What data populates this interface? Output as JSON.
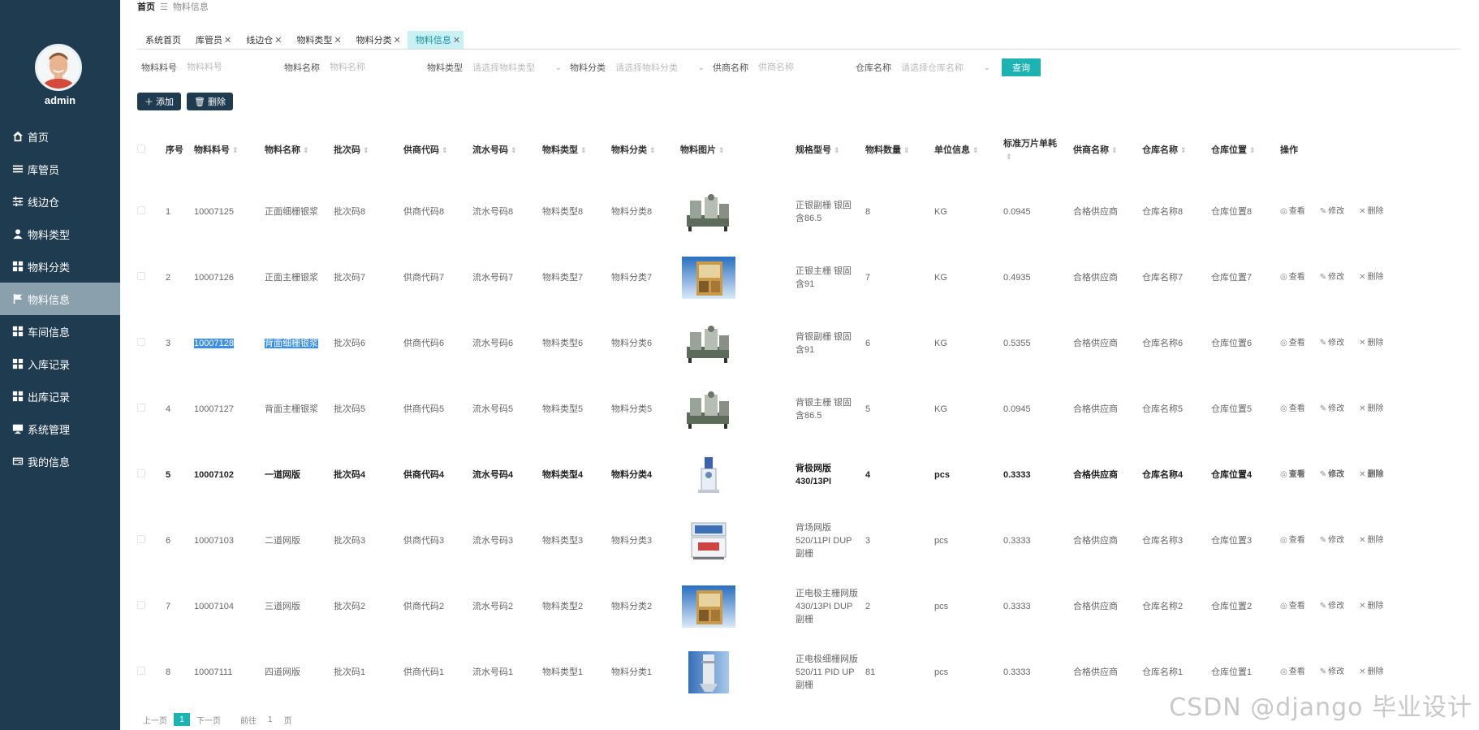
{
  "sidebar": {
    "username": "admin",
    "items": [
      {
        "label": "首页",
        "icon": "home-icon"
      },
      {
        "label": "库管员",
        "icon": "list-icon"
      },
      {
        "label": "线边仓",
        "icon": "sliders-icon"
      },
      {
        "label": "物料类型",
        "icon": "user-icon"
      },
      {
        "label": "物料分类",
        "icon": "grid-icon"
      },
      {
        "label": "物料信息",
        "icon": "flag-icon"
      },
      {
        "label": "车间信息",
        "icon": "grid-icon"
      },
      {
        "label": "入库记录",
        "icon": "grid-icon"
      },
      {
        "label": "出库记录",
        "icon": "grid-icon"
      },
      {
        "label": "系统管理",
        "icon": "monitor-icon"
      },
      {
        "label": "我的信息",
        "icon": "card-icon"
      }
    ]
  },
  "breadcrumb": {
    "home": "首页",
    "sep": "☰",
    "current": "物料信息"
  },
  "tabs": [
    {
      "label": "系统首页",
      "closable": false
    },
    {
      "label": "库管员",
      "closable": true
    },
    {
      "label": "线边仓",
      "closable": true
    },
    {
      "label": "物料类型",
      "closable": true
    },
    {
      "label": "物料分类",
      "closable": true
    },
    {
      "label": "物料信息",
      "closable": true
    }
  ],
  "filters": {
    "code_label": "物料料号",
    "code_placeholder": "物料料号",
    "name_label": "物料名称",
    "name_placeholder": "物料名称",
    "type_label": "物料类型",
    "type_placeholder": "请选择物料类型",
    "cat_label": "物料分类",
    "cat_placeholder": "请选择物料分类",
    "supplier_label": "供商名称",
    "supplier_placeholder": "供商名称",
    "warehouse_label": "仓库名称",
    "warehouse_placeholder": "请选择仓库名称",
    "query_label": "查询"
  },
  "actions": {
    "add_label": "添加",
    "delete_label": "删除"
  },
  "table": {
    "headers": {
      "idx": "序号",
      "code": "物料料号",
      "name": "物料名称",
      "batch": "批次码",
      "sup": "供商代码",
      "flow": "流水号码",
      "type": "物料类型",
      "cat": "物料分类",
      "img": "物料图片",
      "spec": "规格型号",
      "qty": "物料数量",
      "unit": "单位信息",
      "price": "标准万片单耗",
      "sname": "供商名称",
      "wh": "仓库名称",
      "loc": "仓库位置",
      "ops": "操作"
    },
    "ops": {
      "view": "查看",
      "edit": "修改",
      "del": "删除"
    },
    "rows": [
      {
        "idx": "1",
        "code": "10007125",
        "name": "正面细栅银浆",
        "batch": "批次码8",
        "sup": "供商代码8",
        "flow": "流水号码8",
        "type": "物料类型8",
        "cat": "物料分类8",
        "img": "machine",
        "spec": "正银副栅 银固含86.5",
        "qty": "8",
        "unit": "KG",
        "price": "0.0945",
        "sname": "合格供应商",
        "wh": "仓库名称8",
        "loc": "仓库位置8"
      },
      {
        "idx": "2",
        "code": "10007126",
        "name": "正面主栅银浆",
        "batch": "批次码7",
        "sup": "供商代码7",
        "flow": "流水号码7",
        "type": "物料类型7",
        "cat": "物料分类7",
        "img": "cabinet",
        "spec": "正银主栅 银固含91",
        "qty": "7",
        "unit": "KG",
        "price": "0.4935",
        "sname": "合格供应商",
        "wh": "仓库名称7",
        "loc": "仓库位置7"
      },
      {
        "idx": "3",
        "code": "10007128",
        "name": "背面细栅银浆",
        "batch": "批次码6",
        "sup": "供商代码6",
        "flow": "流水号码6",
        "type": "物料类型6",
        "cat": "物料分类6",
        "img": "machine",
        "spec": "背银副栅 银固含91",
        "qty": "6",
        "unit": "KG",
        "price": "0.5355",
        "sname": "合格供应商",
        "wh": "仓库名称6",
        "loc": "仓库位置6",
        "selected": true
      },
      {
        "idx": "4",
        "code": "10007127",
        "name": "背面主栅银浆",
        "batch": "批次码5",
        "sup": "供商代码5",
        "flow": "流水号码5",
        "type": "物料类型5",
        "cat": "物料分类5",
        "img": "machine",
        "spec": "背银主栅 银固含86.5",
        "qty": "5",
        "unit": "KG",
        "price": "0.0945",
        "sname": "合格供应商",
        "wh": "仓库名称5",
        "loc": "仓库位置5"
      },
      {
        "idx": "5",
        "code": "10007102",
        "name": "一道网版",
        "batch": "批次码4",
        "sup": "供商代码4",
        "flow": "流水号码4",
        "type": "物料类型4",
        "cat": "物料分类4",
        "img": "press",
        "spec": "背极网版430/13PI",
        "qty": "4",
        "unit": "pcs",
        "price": "0.3333",
        "sname": "合格供应商",
        "wh": "仓库名称4",
        "loc": "仓库位置4",
        "bold": true
      },
      {
        "idx": "6",
        "code": "10007103",
        "name": "二道网版",
        "batch": "批次码3",
        "sup": "供商代码3",
        "flow": "流水号码3",
        "type": "物料类型3",
        "cat": "物料分类3",
        "img": "tablet",
        "spec": "背场网版520/11PI DUP副栅",
        "qty": "3",
        "unit": "pcs",
        "price": "0.3333",
        "sname": "合格供应商",
        "wh": "仓库名称3",
        "loc": "仓库位置3"
      },
      {
        "idx": "7",
        "code": "10007104",
        "name": "三道网版",
        "batch": "批次码2",
        "sup": "供商代码2",
        "flow": "流水号码2",
        "type": "物料类型2",
        "cat": "物料分类2",
        "img": "cabinet",
        "spec": "正电极主栅网版 430/13PI DUP副栅",
        "qty": "2",
        "unit": "pcs",
        "price": "0.3333",
        "sname": "合格供应商",
        "wh": "仓库名称2",
        "loc": "仓库位置2"
      },
      {
        "idx": "8",
        "code": "10007111",
        "name": "四道网版",
        "batch": "批次码1",
        "sup": "供商代码1",
        "flow": "流水号码1",
        "type": "物料类型1",
        "cat": "物料分类1",
        "img": "tower",
        "spec": "正电极细栅网版520/11 PID UP副栅",
        "qty": "81",
        "unit": "pcs",
        "price": "0.3333",
        "sname": "合格供应商",
        "wh": "仓库名称1",
        "loc": "仓库位置1"
      }
    ]
  },
  "pager": {
    "prev": "上一页",
    "current": "1",
    "next": "下一页",
    "goto": "前往",
    "page_num": "1",
    "page_suffix": "页"
  },
  "watermark": "CSDN @django 毕业设计"
}
